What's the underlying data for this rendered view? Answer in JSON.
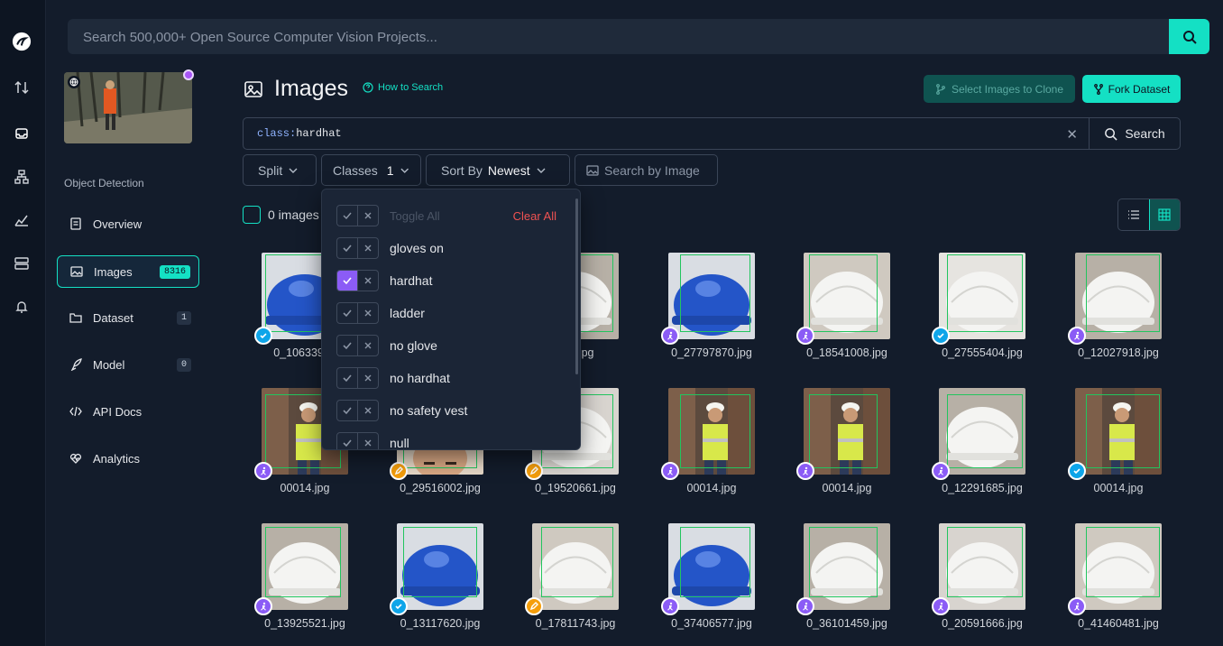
{
  "top_search": {
    "placeholder": "Search 500,000+ Open Source Computer Vision Projects..."
  },
  "project": {
    "type": "Object Detection"
  },
  "nav": [
    {
      "label": "Overview",
      "icon": "document-icon",
      "badge": ""
    },
    {
      "label": "Images",
      "icon": "image-icon",
      "badge": "8316"
    },
    {
      "label": "Dataset",
      "icon": "folder-icon",
      "badge": "1"
    },
    {
      "label": "Model",
      "icon": "rocket-icon",
      "badge": "0"
    },
    {
      "label": "API Docs",
      "icon": "code-icon",
      "badge": ""
    },
    {
      "label": "Analytics",
      "icon": "heart-pulse-icon",
      "badge": ""
    }
  ],
  "page": {
    "title": "Images",
    "how_to": "How to Search",
    "select_clone": "Select Images to Clone",
    "fork": "Fork Dataset"
  },
  "query": {
    "key": "class:",
    "value": "hardhat",
    "search_label": "Search"
  },
  "filters": {
    "split": "Split",
    "classes": "Classes",
    "classes_count": "1",
    "sort_by": "Sort By",
    "sort_value": "Newest",
    "search_by_image": "Search by Image"
  },
  "selection": {
    "count_text": "0 images"
  },
  "dropdown": {
    "toggle_all": "Toggle All",
    "clear_all": "Clear All",
    "items": [
      {
        "label": "gloves on",
        "checked": false
      },
      {
        "label": "hardhat",
        "checked": true
      },
      {
        "label": "ladder",
        "checked": false
      },
      {
        "label": "no glove",
        "checked": false
      },
      {
        "label": "no hardhat",
        "checked": false
      },
      {
        "label": "no safety vest",
        "checked": false
      },
      {
        "label": "null",
        "checked": false
      }
    ]
  },
  "grid": {
    "rows": [
      [
        {
          "name": "0_10633982",
          "tag": "b",
          "kind": "blue"
        },
        {
          "name": "",
          "tag": "",
          "kind": "hidden"
        },
        {
          "name": "600.jpg",
          "tag": "",
          "kind": "white"
        },
        {
          "name": "0_27797870.jpg",
          "tag": "p",
          "kind": "blue"
        },
        {
          "name": "0_18541008.jpg",
          "tag": "p",
          "kind": "white"
        },
        {
          "name": "0_27555404.jpg",
          "tag": "b",
          "kind": "white"
        },
        {
          "name": "0_12027918.jpg",
          "tag": "p",
          "kind": "white"
        }
      ],
      [
        {
          "name": "00014.jpg",
          "tag": "p",
          "kind": "worker"
        },
        {
          "name": "0_29516002.jpg",
          "tag": "o",
          "kind": "face"
        },
        {
          "name": "0_19520661.jpg",
          "tag": "o",
          "kind": "white"
        },
        {
          "name": "00014.jpg",
          "tag": "p",
          "kind": "worker"
        },
        {
          "name": "00014.jpg",
          "tag": "p",
          "kind": "worker"
        },
        {
          "name": "0_12291685.jpg",
          "tag": "p",
          "kind": "white"
        },
        {
          "name": "00014.jpg",
          "tag": "b",
          "kind": "worker"
        }
      ],
      [
        {
          "name": "0_13925521.jpg",
          "tag": "p",
          "kind": "white"
        },
        {
          "name": "0_13117620.jpg",
          "tag": "b",
          "kind": "blue"
        },
        {
          "name": "0_17811743.jpg",
          "tag": "o",
          "kind": "white"
        },
        {
          "name": "0_37406577.jpg",
          "tag": "p",
          "kind": "blue"
        },
        {
          "name": "0_36101459.jpg",
          "tag": "p",
          "kind": "white"
        },
        {
          "name": "0_20591666.jpg",
          "tag": "p",
          "kind": "white"
        },
        {
          "name": "0_41460481.jpg",
          "tag": "p",
          "kind": "white"
        }
      ]
    ]
  },
  "colors": {
    "accent": "#14e0c4",
    "purple": "#8b5cf6",
    "danger": "#f05252"
  }
}
